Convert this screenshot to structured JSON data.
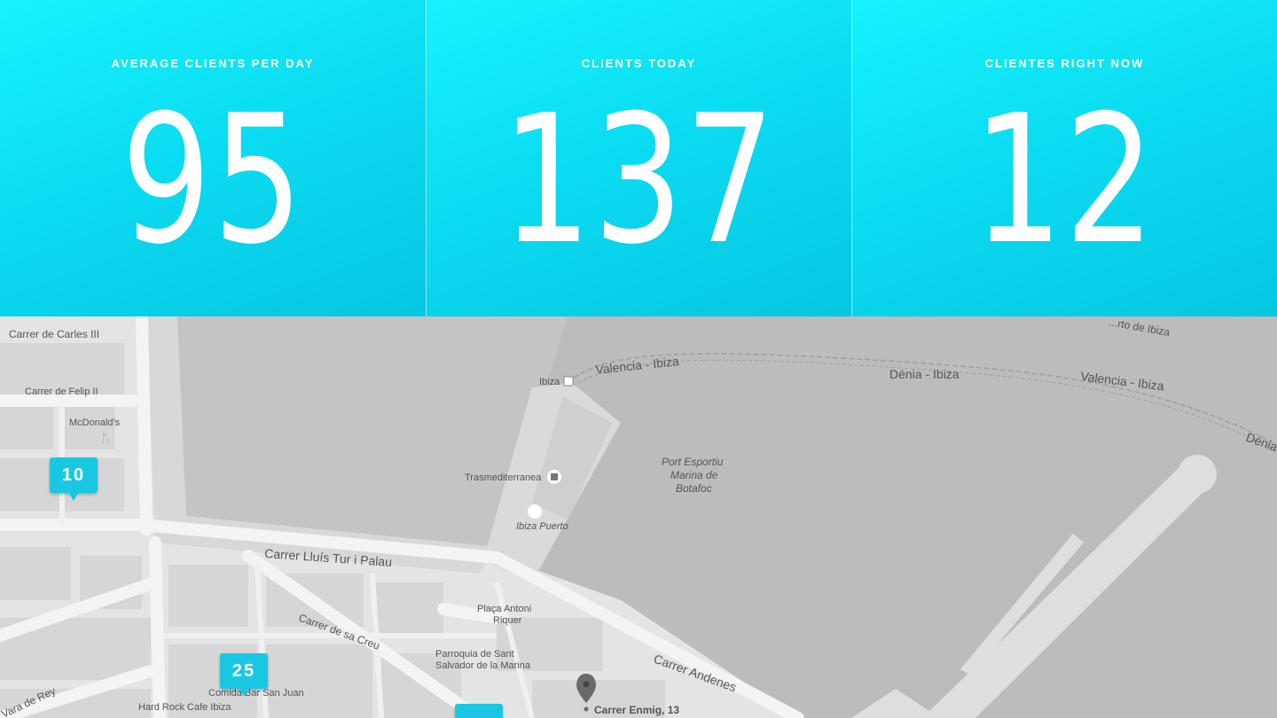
{
  "stats": [
    {
      "label": "AVERAGE CLIENTS PER DAY",
      "value": "95"
    },
    {
      "label": "CLIENTS TODAY",
      "value": "137"
    },
    {
      "label": "CLIENTES RIGHT NOW",
      "value": "12"
    }
  ],
  "map": {
    "labels": {
      "carles": "Carrer de Carles III",
      "felip": "Carrer de Felip II",
      "mcdonalds": "McDonald's",
      "valencia1": "Valencia - Ibiza",
      "ibiza": "Ibiza",
      "denia": "Dénia - Ibiza",
      "valencia2": "Valencia - Ibiza",
      "denia2": "Dénia",
      "puerto": "...rto de Ibiza",
      "trasme": "Trasmediterranea",
      "ibizapuerto": "Ibiza Puerto",
      "port1": "Port Esportiu",
      "port2": "Marina de",
      "port3": "Botafoc",
      "lluis": "Carrer Lluís Tur i Palau",
      "creu": "Carrer de sa Creu",
      "placa1": "Plaça Antoni",
      "placa2": "Riquer",
      "parr1": "Parroquia de Sant",
      "parr2": "Salvador de la Marina",
      "andenes": "Carrer Andenes",
      "enmig": "Carrer Enmig, 13",
      "comida": "Comida Bar San Juan",
      "hardrock": "Hard Rock Cafe Ibiza",
      "vara": "Vara de Rey"
    },
    "pins": [
      {
        "count": "10"
      },
      {
        "count": "25"
      },
      {
        "count": ""
      }
    ]
  },
  "colors": {
    "accent": "#18c8e2",
    "map_water": "#bdbdbd",
    "map_land": "#e6e6e6"
  }
}
